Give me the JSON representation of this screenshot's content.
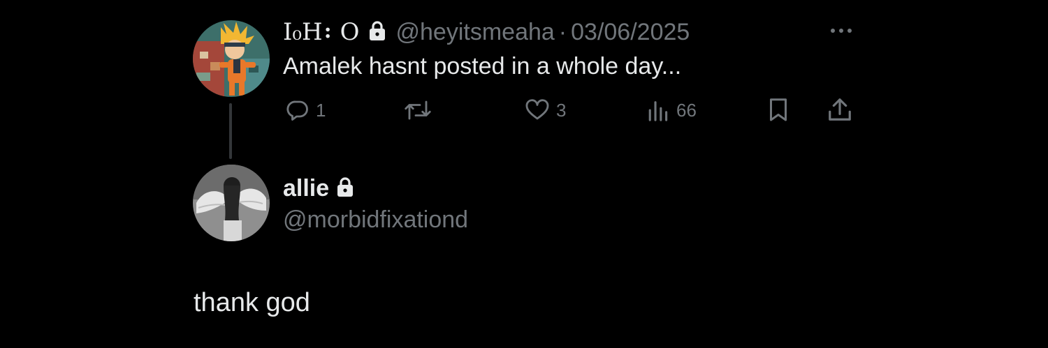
{
  "tweet": {
    "display_name": "I₀H⠆O",
    "handle": "@heyitsmeaha",
    "separator": "·",
    "date": "03/06/2025",
    "text": "Amalek hasnt posted in a whole day...",
    "actions": {
      "replies": "1",
      "retweets": "",
      "likes": "3",
      "views": "66"
    },
    "avatar_icon": "anime-character-avatar",
    "more_icon": "more-horizontal-icon"
  },
  "reply_author": {
    "display_name": "allie",
    "handle": "@morbidfixationd",
    "avatar_icon": "angel-wings-person-avatar"
  },
  "reply_text": "thank god",
  "colors": {
    "background": "#000000",
    "primary_text": "#e7e9ea",
    "secondary_text": "#71767b",
    "thread_line": "#333639"
  }
}
